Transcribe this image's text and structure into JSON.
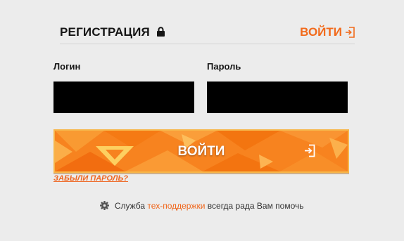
{
  "header": {
    "title": "РЕГИСТРАЦИЯ",
    "login_link": "ВОЙТИ"
  },
  "form": {
    "login_label": "Логин",
    "login_value": "",
    "password_label": "Пароль",
    "password_value": "",
    "submit_label": "ВОЙТИ",
    "forgot_password": "ЗАБЫЛИ ПАРОЛЬ?"
  },
  "support": {
    "prefix": "Служба",
    "link": "тех-поддержки",
    "suffix": "всегда рада Вам помочь"
  },
  "icons": {
    "lock": "lock-icon",
    "login": "login-icon",
    "submit": "login-icon",
    "support": "gear-icon"
  },
  "colors": {
    "accent": "#f26a1b",
    "button": "#f7831f",
    "input_bg": "#000000",
    "background": "#ececec"
  }
}
